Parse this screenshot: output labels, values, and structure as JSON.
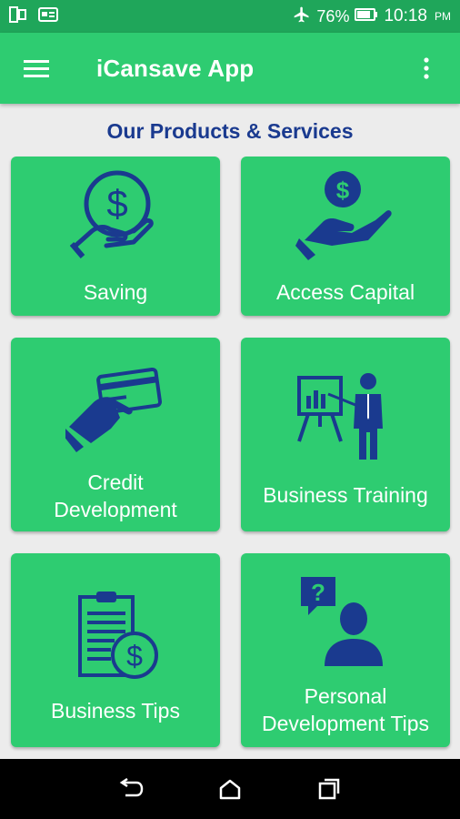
{
  "status_bar": {
    "battery": "76%",
    "time": "10:18",
    "ampm": "PM"
  },
  "app_bar": {
    "title": "iCansave App"
  },
  "section": {
    "title": "Our Products & Services"
  },
  "tiles": [
    {
      "label": "Saving",
      "icon": "hand-dollar-coin-icon"
    },
    {
      "label": "Access Capital",
      "icon": "hand-receiving-coin-icon"
    },
    {
      "label": "Credit\nDevelopment",
      "icon": "hand-credit-card-icon"
    },
    {
      "label": "Business Training",
      "icon": "presenter-board-icon"
    },
    {
      "label": "Business Tips",
      "icon": "clipboard-dollar-icon"
    },
    {
      "label": "Personal\nDevelopment Tips",
      "icon": "person-question-icon"
    }
  ],
  "colors": {
    "status_bar": "#1fa65a",
    "app_bar": "#2ecc71",
    "tile": "#2ecc71",
    "icon": "#1a3a8f",
    "section_title": "#1a3a8f",
    "background": "#ececec"
  }
}
